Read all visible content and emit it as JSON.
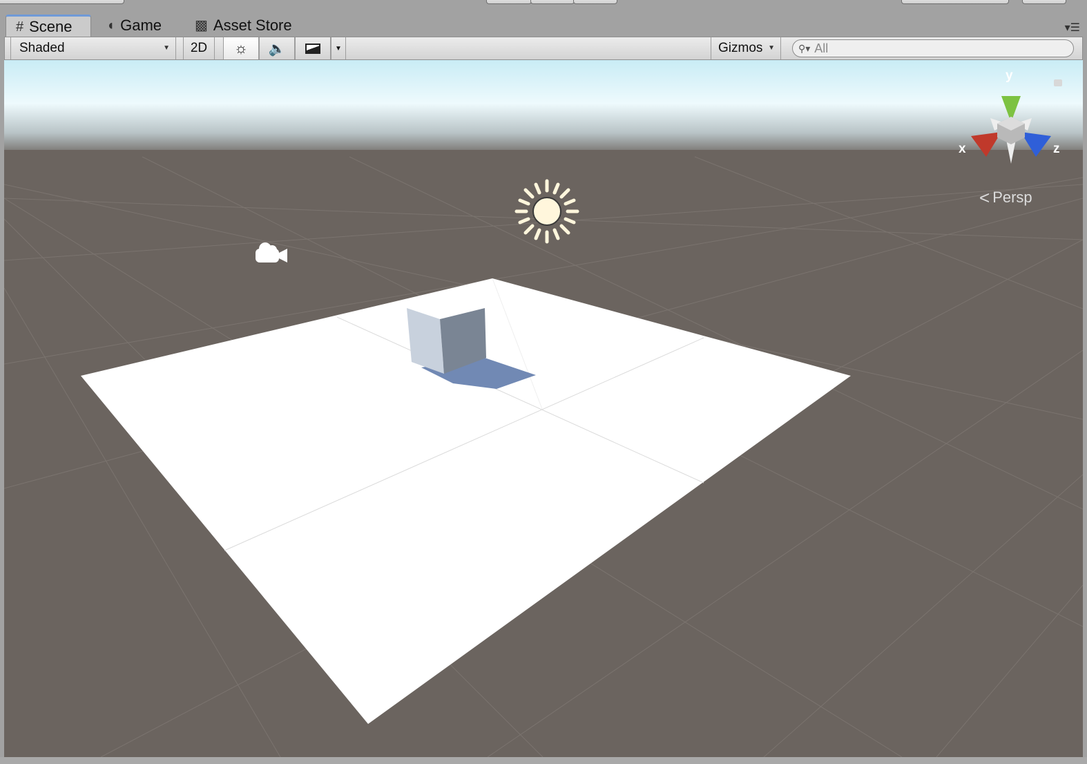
{
  "tabs": [
    {
      "label": "Scene",
      "icon": "grid-icon",
      "active": true
    },
    {
      "label": "Game",
      "icon": "pacman-icon",
      "active": false
    },
    {
      "label": "Asset Store",
      "icon": "shopping-bag-icon",
      "active": false
    }
  ],
  "toolbar": {
    "shading_mode": "Shaded",
    "mode_2d_label": "2D",
    "lighting_icon": "sun-icon",
    "audio_icon": "speaker-icon",
    "effects_icon": "image-icon",
    "gizmos_label": "Gizmos",
    "search_placeholder": "All"
  },
  "gizmo": {
    "x_label": "x",
    "y_label": "y",
    "z_label": "z",
    "projection_label": "Persp",
    "colors": {
      "x": "#c0392b",
      "y": "#7dc242",
      "z": "#2f5fd8"
    }
  },
  "scene": {
    "sky_color": "#e6f7fb",
    "ground_color": "#6b645f",
    "plane_color": "#ffffff",
    "cube_color": "#aeb8c6",
    "shadow_color": "#7189b4",
    "light_icon": "directional-light-icon",
    "camera_icon": "camera-icon"
  }
}
